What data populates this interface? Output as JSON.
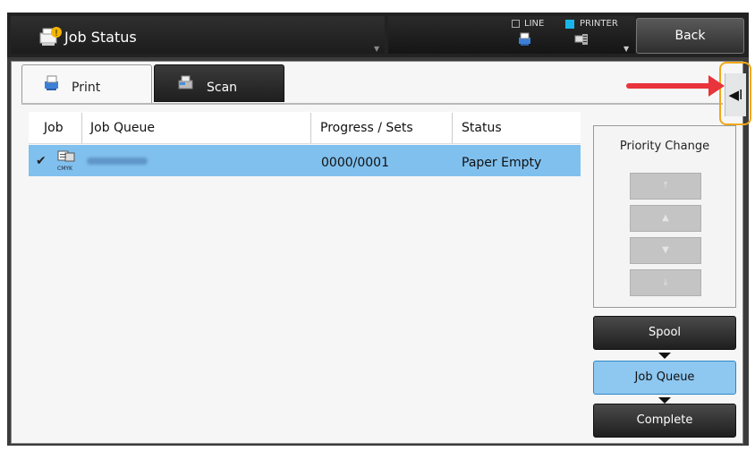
{
  "header": {
    "title": "Job Status",
    "modes": {
      "line_label": "LINE",
      "printer_label": "PRINTER"
    },
    "back_label": "Back"
  },
  "tabs": [
    {
      "label": "Print",
      "active": true
    },
    {
      "label": "Scan",
      "active": false
    }
  ],
  "table": {
    "columns": [
      "Job",
      "Job Queue",
      "Progress / Sets",
      "Status"
    ],
    "rows": [
      {
        "selected": true,
        "color_mode": "CMYK",
        "job_name": "",
        "progress": "0000/0001",
        "status": "Paper Empty"
      }
    ]
  },
  "side_panel": {
    "collapse_glyph": "◀I",
    "priority_label": "Priority Change",
    "flow": [
      "Spool",
      "Job Queue",
      "Complete"
    ],
    "active_flow": "Job Queue"
  },
  "colors": {
    "accent": "#19b7e8",
    "selection": "#80c0ee",
    "annotation_red": "#e8343a",
    "annotation_orange": "#f0a818"
  }
}
